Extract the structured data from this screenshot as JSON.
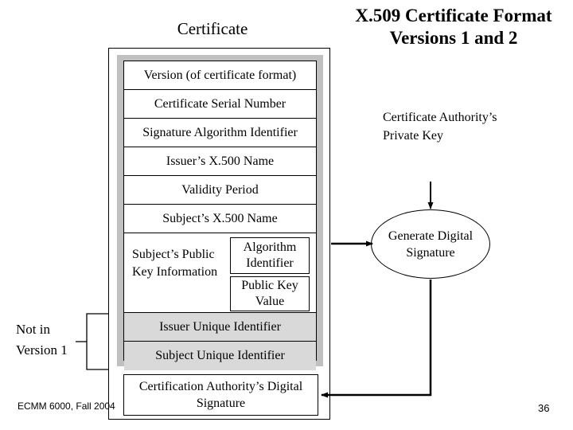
{
  "slide": {
    "title": "X.509 Certificate Format Versions 1 and 2",
    "title_line1": "X.509 Certificate Format",
    "title_line2": "Versions 1 and 2",
    "page_number": "36",
    "footer": "ECMM 6000, Fall 2004"
  },
  "certificate": {
    "caption": "Certificate",
    "fields": [
      {
        "label": "Version (of certificate format)",
        "shaded": false
      },
      {
        "label": "Certificate Serial Number",
        "shaded": false
      },
      {
        "label": "Signature Algorithm Identifier",
        "shaded": false
      },
      {
        "label": "Issuer’s X.500 Name",
        "shaded": false
      },
      {
        "label": "Validity Period",
        "shaded": false
      },
      {
        "label": "Subject’s X.500 Name",
        "shaded": false
      }
    ],
    "public_key_row": {
      "label": "Subject’s Public Key Information",
      "algorithm_identifier": "Algorithm Identifier",
      "public_key_value": "Public Key Value"
    },
    "shaded_fields": [
      {
        "label": "Issuer Unique Identifier",
        "shaded": true
      },
      {
        "label": "Subject Unique Identifier",
        "shaded": true
      }
    ],
    "signature_box": "Certification Authority’s Digital Signature"
  },
  "annotations": {
    "not_in_version_1": "Not in Version 1",
    "ca_private_key": "Certificate Authority’s Private Key",
    "generate_digital_signature": "Generate Digital Signature"
  },
  "colors": {
    "shaded_row": "#d9d9d9",
    "group_border": "#c0c0c0",
    "line": "#000000",
    "background": "#ffffff"
  }
}
